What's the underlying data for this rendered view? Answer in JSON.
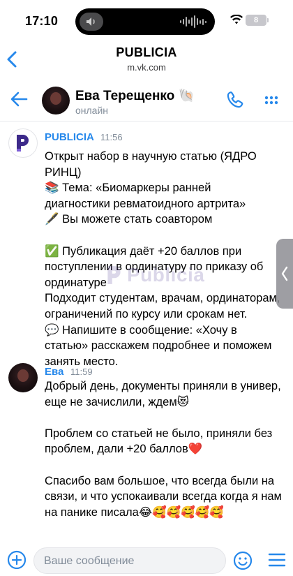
{
  "status_bar": {
    "time": "17:10",
    "battery": "8"
  },
  "browser": {
    "title": "PUBLICIA",
    "url": "m.vk.com"
  },
  "chat": {
    "contact_name": "Ева Терещенко",
    "contact_badge": "🐚",
    "contact_status": "онлайн"
  },
  "messages": [
    {
      "author": "PUBLICIA",
      "time": "11:56",
      "lines": [
        "Открыт набор в научную статью (ЯДРО",
        "РИНЦ)",
        "📚 Тема: «Биомаркеры ранней",
        "диагностики ревматоидного артрита»",
        "🖋️ Вы можете стать соавтором",
        "",
        "✅ Публикация даёт +20 баллов при",
        "поступлении в ординатуру по приказу об",
        "ординатуре",
        "Подходит студентам, врачам, ординаторам,",
        "ограничений по курсу или срокам нет.",
        "💬 Напишите в сообщение: «Хочу в",
        "статью» расскажем подробнее и поможем",
        "занять место."
      ]
    },
    {
      "author": "Ева",
      "time": "11:59",
      "lines": [
        "Добрый день, документы приняли в универ,",
        "еще не зачислили, ждем😻",
        "",
        "Проблем со статьей не было, приняли без",
        "проблем, дали +20 баллов❤️",
        "",
        "Спасибо вам большое, что всегда были на",
        "связи, и что успокаивали всегда когда я нам",
        "на панике писала😂🥰🥰🥰🥰🥰"
      ]
    }
  ],
  "watermark": "Publicia",
  "composer": {
    "placeholder": "Ваше сообщение"
  },
  "colors": {
    "accent": "#2688eb",
    "brand": "#3d2a8a",
    "secondary_text": "#818c99"
  }
}
